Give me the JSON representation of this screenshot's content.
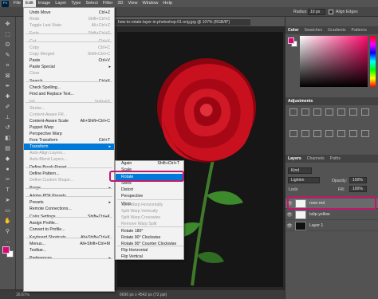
{
  "menubar": {
    "logo": "Ps",
    "items": [
      "File",
      "Edit",
      "Image",
      "Layer",
      "Type",
      "Select",
      "Filter",
      "3D",
      "View",
      "Window",
      "Help"
    ]
  },
  "options": {
    "radius_label": "Radius:",
    "radius_value": "10 px",
    "align_edges": "Align Edges"
  },
  "document": {
    "tab_title": "how-to-rotate-layer-in-photoshop-01-orig.jpg @ 107% (RGB/8*)",
    "zoom": "16.67%",
    "doc_info": "6696 px x 4542 px (72 ppi)"
  },
  "edit_menu": [
    {
      "label": "Undo Move",
      "shortcut": "Ctrl+Z",
      "disabled": false
    },
    {
      "label": "Redo",
      "shortcut": "Shift+Ctrl+Z",
      "disabled": true
    },
    {
      "label": "Toggle Last State",
      "shortcut": "Alt+Ctrl+Z",
      "disabled": true
    },
    {
      "label": "Fade...",
      "shortcut": "Shift+Ctrl+F",
      "disabled": true
    },
    {
      "label": "Cut",
      "shortcut": "Ctrl+X",
      "disabled": true
    },
    {
      "label": "Copy",
      "shortcut": "Ctrl+C",
      "disabled": true
    },
    {
      "label": "Copy Merged",
      "shortcut": "Shift+Ctrl+C",
      "disabled": true
    },
    {
      "label": "Paste",
      "shortcut": "Ctrl+V",
      "disabled": false
    },
    {
      "label": "Paste Special",
      "shortcut": "",
      "disabled": false
    },
    {
      "label": "Clear",
      "shortcut": "",
      "disabled": true
    },
    {
      "label": "Search",
      "shortcut": "Ctrl+F",
      "disabled": false
    },
    {
      "label": "Check Spelling...",
      "shortcut": "",
      "disabled": false
    },
    {
      "label": "Find and Replace Text...",
      "shortcut": "",
      "disabled": false
    },
    {
      "label": "Fill...",
      "shortcut": "Shift+F5",
      "disabled": true
    },
    {
      "label": "Stroke...",
      "shortcut": "",
      "disabled": true
    },
    {
      "label": "Content-Aware Fill...",
      "shortcut": "",
      "disabled": true
    },
    {
      "label": "Content-Aware Scale",
      "shortcut": "Alt+Shift+Ctrl+C",
      "disabled": false
    },
    {
      "label": "Puppet Warp",
      "shortcut": "",
      "disabled": false
    },
    {
      "label": "Perspective Warp",
      "shortcut": "",
      "disabled": false
    },
    {
      "label": "Free Transform",
      "shortcut": "Ctrl+T",
      "disabled": false
    },
    {
      "label": "Transform",
      "shortcut": "",
      "disabled": false
    },
    {
      "label": "Auto-Align Layers...",
      "shortcut": "",
      "disabled": true
    },
    {
      "label": "Auto-Blend Layers...",
      "shortcut": "",
      "disabled": true
    },
    {
      "label": "Define Brush Preset...",
      "shortcut": "",
      "disabled": false
    },
    {
      "label": "Define Pattern...",
      "shortcut": "",
      "disabled": false
    },
    {
      "label": "Define Custom Shape...",
      "shortcut": "",
      "disabled": true
    },
    {
      "label": "Purge",
      "shortcut": "",
      "disabled": false
    },
    {
      "label": "Adobe PDF Presets...",
      "shortcut": "",
      "disabled": false
    },
    {
      "label": "Presets",
      "shortcut": "",
      "disabled": false
    },
    {
      "label": "Remote Connections...",
      "shortcut": "",
      "disabled": false
    },
    {
      "label": "Color Settings...",
      "shortcut": "Shift+Ctrl+K",
      "disabled": false
    },
    {
      "label": "Assign Profile...",
      "shortcut": "",
      "disabled": false
    },
    {
      "label": "Convert to Profile...",
      "shortcut": "",
      "disabled": false
    },
    {
      "label": "Keyboard Shortcuts...",
      "shortcut": "Alt+Shift+Ctrl+K",
      "disabled": false
    },
    {
      "label": "Menus...",
      "shortcut": "Alt+Shift+Ctrl+M",
      "disabled": false
    },
    {
      "label": "Toolbar...",
      "shortcut": "",
      "disabled": false
    },
    {
      "label": "Preferences",
      "shortcut": "",
      "disabled": false
    }
  ],
  "transform_menu": [
    {
      "label": "Again",
      "shortcut": "Shift+Ctrl+T",
      "disabled": false
    },
    {
      "label": "Scale",
      "shortcut": "",
      "disabled": false
    },
    {
      "label": "Rotate",
      "shortcut": "",
      "disabled": false
    },
    {
      "label": "Skew",
      "shortcut": "",
      "disabled": false
    },
    {
      "label": "Distort",
      "shortcut": "",
      "disabled": false
    },
    {
      "label": "Perspective",
      "shortcut": "",
      "disabled": false
    },
    {
      "label": "Warp",
      "shortcut": "",
      "disabled": false
    },
    {
      "label": "Split Warp Horizontally",
      "shortcut": "",
      "disabled": true
    },
    {
      "label": "Split Warp Vertically",
      "shortcut": "",
      "disabled": true
    },
    {
      "label": "Split Warp Crosswise",
      "shortcut": "",
      "disabled": true
    },
    {
      "label": "Remove Warp Split",
      "shortcut": "",
      "disabled": true
    },
    {
      "label": "Rotate 180°",
      "shortcut": "",
      "disabled": false
    },
    {
      "label": "Rotate 90° Clockwise",
      "shortcut": "",
      "disabled": false
    },
    {
      "label": "Rotate 90° Counter Clockwise",
      "shortcut": "",
      "disabled": false
    },
    {
      "label": "Flip Horizontal",
      "shortcut": "",
      "disabled": false
    },
    {
      "label": "Flip Vertical",
      "shortcut": "",
      "disabled": false
    }
  ],
  "color_panel": {
    "tabs": [
      "Color",
      "Swatches",
      "Gradients",
      "Patterns"
    ],
    "foreground": "#e3007a",
    "background": "#ffffff"
  },
  "adjustments_panel": {
    "tab": "Adjustments"
  },
  "layers_panel": {
    "tabs": [
      "Layers",
      "Channels",
      "Paths"
    ],
    "filter": "Kind",
    "blend_mode": "Lighten",
    "opacity_label": "Opacity:",
    "opacity_value": "100%",
    "lock_label": "Lock:",
    "fill_label": "Fill:",
    "fill_value": "100%",
    "layers": [
      {
        "name": "rose-red",
        "selected": true
      },
      {
        "name": "tulip-yellow",
        "selected": false
      },
      {
        "name": "Layer 1",
        "selected": false
      }
    ]
  },
  "icons": {
    "eye": "👁",
    "submenu_arrow": "▸",
    "tools": [
      "move-icon",
      "marquee-icon",
      "lasso-icon",
      "quick-select-icon",
      "crop-icon",
      "frame-icon",
      "eyedropper-icon",
      "healing-icon",
      "brush-icon",
      "clone-stamp-icon",
      "history-brush-icon",
      "eraser-icon",
      "gradient-icon",
      "blur-icon",
      "dodge-icon",
      "pen-icon",
      "type-icon",
      "path-select-icon",
      "rectangle-icon",
      "hand-icon",
      "zoom-icon",
      "more-tools-icon"
    ]
  },
  "colors": {
    "menu_highlight": "#0079d8",
    "annotation": "#c2186b",
    "rose": "#c8101e"
  }
}
